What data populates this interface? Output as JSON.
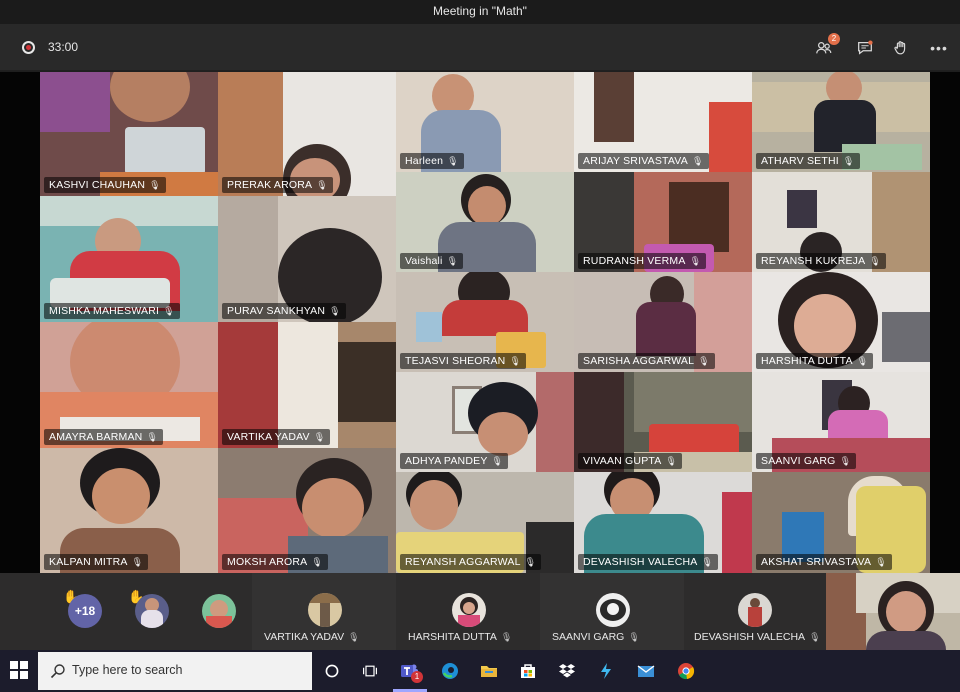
{
  "window": {
    "title": "Meeting in \"Math\""
  },
  "toolbar": {
    "timer": "33:00",
    "participants_badge": "2",
    "icons": [
      "record-icon",
      "participants-icon",
      "chat-icon",
      "raise-hand-icon",
      "more-icon"
    ],
    "more": "•••"
  },
  "tiles": [
    {
      "name": "KASHVI  CHAUHAN"
    },
    {
      "name": "PRERAK  ARORA"
    },
    {
      "name": "Harleen"
    },
    {
      "name": "ARIJAY  SRIVASTAVA"
    },
    {
      "name": "ATHARV  SETHI"
    },
    {
      "name": "Vaishali"
    },
    {
      "name": "RUDRANSH  VERMA"
    },
    {
      "name": "REYANSH  KUKREJA"
    },
    {
      "name": "MISHKA  MAHESWARI"
    },
    {
      "name": "PURAV  SANKHYAN"
    },
    {
      "name": "TEJASVI  SHEORAN"
    },
    {
      "name": "SARISHA  AGGARWAL"
    },
    {
      "name": "HARSHITA  DUTTA"
    },
    {
      "name": "AMAYRA  BARMAN"
    },
    {
      "name": "VARTIKA  YADAV"
    },
    {
      "name": "ADHYA  PANDEY"
    },
    {
      "name": "VIVAAN   GUPTA"
    },
    {
      "name": "SAANVI   GARG"
    },
    {
      "name": "KALPAN  MITRA"
    },
    {
      "name": "MOKSH  ARORA"
    },
    {
      "name": "REYANSH   AGGARWAL"
    },
    {
      "name": "DEVASHISH  VALECHA"
    },
    {
      "name": "AKSHAT  SRIVASTAVA"
    }
  ],
  "strip": {
    "more_count": "+18",
    "participants": [
      {
        "name": "VARTIKA  YADAV"
      },
      {
        "name": "HARSHITA  DUTTA"
      },
      {
        "name": "SAANVI  GARG"
      },
      {
        "name": "DEVASHISH  VALECHA"
      }
    ]
  },
  "taskbar": {
    "search_placeholder": "Type here to search",
    "teams_badge": "1",
    "apps": [
      "cortana-icon",
      "task-view-icon",
      "teams-icon",
      "edge-icon",
      "file-explorer-icon",
      "store-icon",
      "dropbox-icon",
      "app-icon",
      "mail-icon",
      "chrome-icon"
    ]
  },
  "colors": {
    "accent": "#6264a7",
    "record": "#d13438",
    "badge": "#e3704a"
  }
}
